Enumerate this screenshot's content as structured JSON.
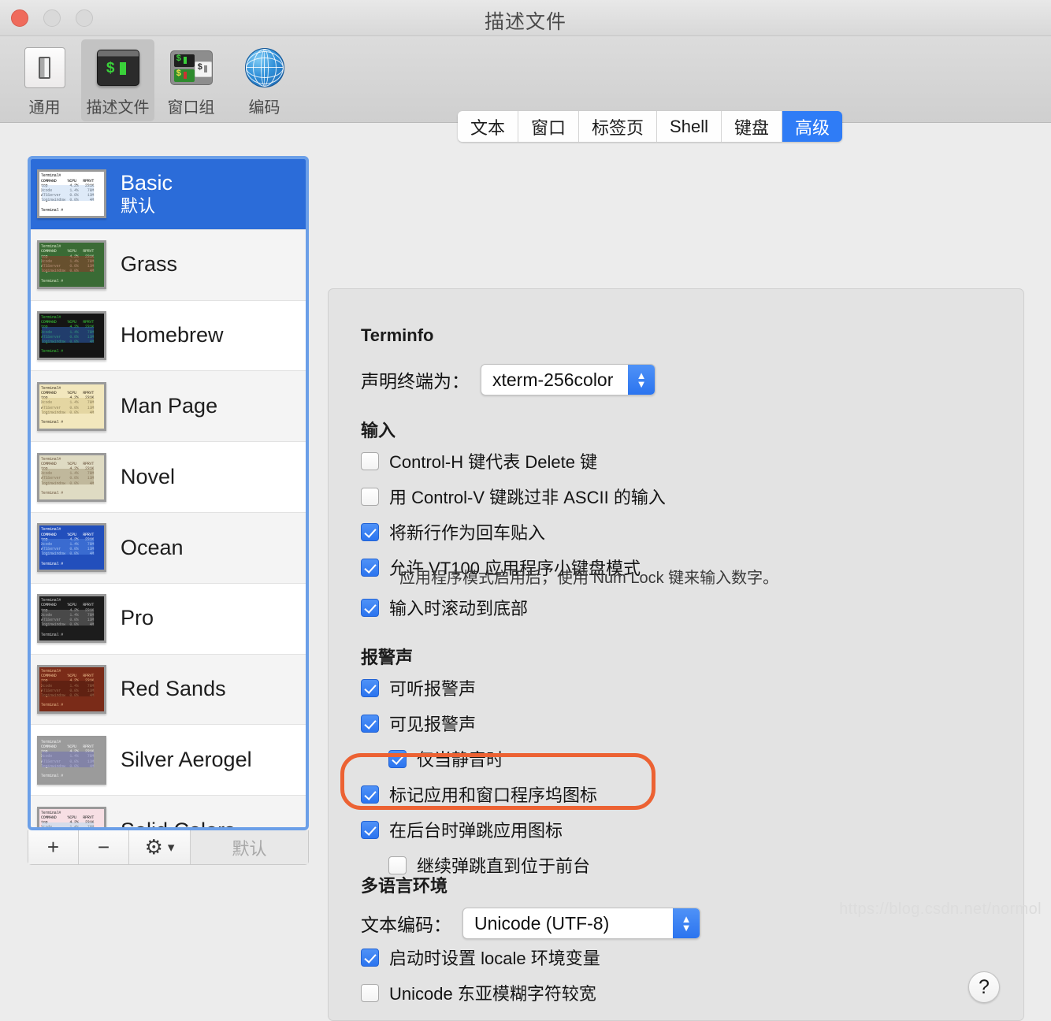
{
  "window": {
    "title": "描述文件",
    "controls": {
      "close": "close-icon",
      "minimize": "minimize-icon",
      "maximize": "maximize-icon"
    }
  },
  "toolbar": {
    "items": [
      {
        "label": "通用",
        "icon": "toggle-switch-icon",
        "selected": false
      },
      {
        "label": "描述文件",
        "icon": "terminal-window-icon",
        "selected": true
      },
      {
        "label": "窗口组",
        "icon": "window-group-icon",
        "selected": false
      },
      {
        "label": "编码",
        "icon": "globe-icon",
        "selected": false
      }
    ]
  },
  "profiles": {
    "thumbnail_text": "Terminal#\nCOMMAND     %CPU   RPRVT\ntop          4.2%   231K\nXcode        1.4%    78M\nATSServer    0.0%    13M\nloginwindow  0.0%     4M\n\nTerminal #",
    "items": [
      {
        "name": "Basic",
        "sub": "默认",
        "selected": true,
        "bg": "#ffffff",
        "fg": "#000000",
        "hl": "#c3d9f2"
      },
      {
        "name": "Grass",
        "sub": "",
        "selected": false,
        "bg": "#3a6b35",
        "fg": "#d8e8c8",
        "hl": "#8c3a28"
      },
      {
        "name": "Homebrew",
        "sub": "",
        "selected": false,
        "bg": "#151515",
        "fg": "#37c837",
        "hl": "#2b5fb5"
      },
      {
        "name": "Man Page",
        "sub": "",
        "selected": false,
        "bg": "#f2e7bd",
        "fg": "#3a3020",
        "hl": "#d9c98c"
      },
      {
        "name": "Novel",
        "sub": "",
        "selected": false,
        "bg": "#dfdbc3",
        "fg": "#67503a",
        "hl": "#a59a7c"
      },
      {
        "name": "Ocean",
        "sub": "",
        "selected": false,
        "bg": "#224fbc",
        "fg": "#ffffff",
        "hl": "#4f84e0"
      },
      {
        "name": "Pro",
        "sub": "",
        "selected": false,
        "bg": "#1c1c1c",
        "fg": "#cfcfcf",
        "hl": "#6f6f6f"
      },
      {
        "name": "Red Sands",
        "sub": "",
        "selected": false,
        "bg": "#7a2b18",
        "fg": "#e9b98a",
        "hl": "#4b1a0e"
      },
      {
        "name": "Silver Aerogel",
        "sub": "",
        "selected": false,
        "bg": "#9b9b9b",
        "fg": "#f2f2f2",
        "hl": "#6d6fb0"
      },
      {
        "name": "Solid Colors",
        "sub": "",
        "selected": false,
        "bg": "#f7dfe4",
        "fg": "#2b2b2b",
        "hl": "#bcd9ef"
      }
    ],
    "toolbar": {
      "add": "+",
      "remove": "−",
      "gear": "gear-icon",
      "gear_chevron": "chevron-down-icon",
      "default_button": "默认"
    }
  },
  "tabs": [
    {
      "label": "文本",
      "active": false
    },
    {
      "label": "窗口",
      "active": false
    },
    {
      "label": "标签页",
      "active": false
    },
    {
      "label": "Shell",
      "active": false
    },
    {
      "label": "键盘",
      "active": false
    },
    {
      "label": "高级",
      "active": true
    }
  ],
  "advanced": {
    "terminfo": {
      "title": "Terminfo",
      "declare_label": "声明终端为：",
      "declare_value": "xterm-256color"
    },
    "input": {
      "title": "输入",
      "options": [
        {
          "label": "Control-H 键代表 Delete 键",
          "checked": false,
          "indent": 0
        },
        {
          "label": "用 Control-V 键跳过非 ASCII 的输入",
          "checked": false,
          "indent": 0
        },
        {
          "label": "将新行作为回车贴入",
          "checked": true,
          "indent": 0
        },
        {
          "label": "允许 VT100 应用程序小键盘模式",
          "checked": true,
          "indent": 0
        }
      ],
      "note": "应用程序模式启用后，使用 Num Lock 键来输入数字。",
      "options_after_note": [
        {
          "label": "输入时滚动到底部",
          "checked": true,
          "indent": 0
        }
      ]
    },
    "alert": {
      "title": "报警声",
      "options": [
        {
          "label": "可听报警声",
          "checked": true,
          "indent": 0
        },
        {
          "label": "可见报警声",
          "checked": true,
          "indent": 0
        },
        {
          "label": "仅当静音时",
          "checked": true,
          "indent": 1
        },
        {
          "label": "标记应用和窗口程序坞图标",
          "checked": true,
          "indent": 0
        },
        {
          "label": "在后台时弹跳应用图标",
          "checked": true,
          "indent": 0
        },
        {
          "label": "继续弹跳直到位于前台",
          "checked": false,
          "indent": 1
        }
      ]
    },
    "multilingual": {
      "title": "多语言环境",
      "encoding_label": "文本编码：",
      "encoding_value": "Unicode (UTF-8)",
      "options": [
        {
          "label": "启动时设置 locale 环境变量",
          "checked": true,
          "highlighted": true
        },
        {
          "label": "Unicode 东亚模糊字符较宽",
          "checked": false,
          "highlighted": false
        }
      ]
    },
    "help_button": "?"
  },
  "annotation": {
    "highlight_color": "#ec6233"
  },
  "watermark": "https://blog.csdn.net/normol"
}
